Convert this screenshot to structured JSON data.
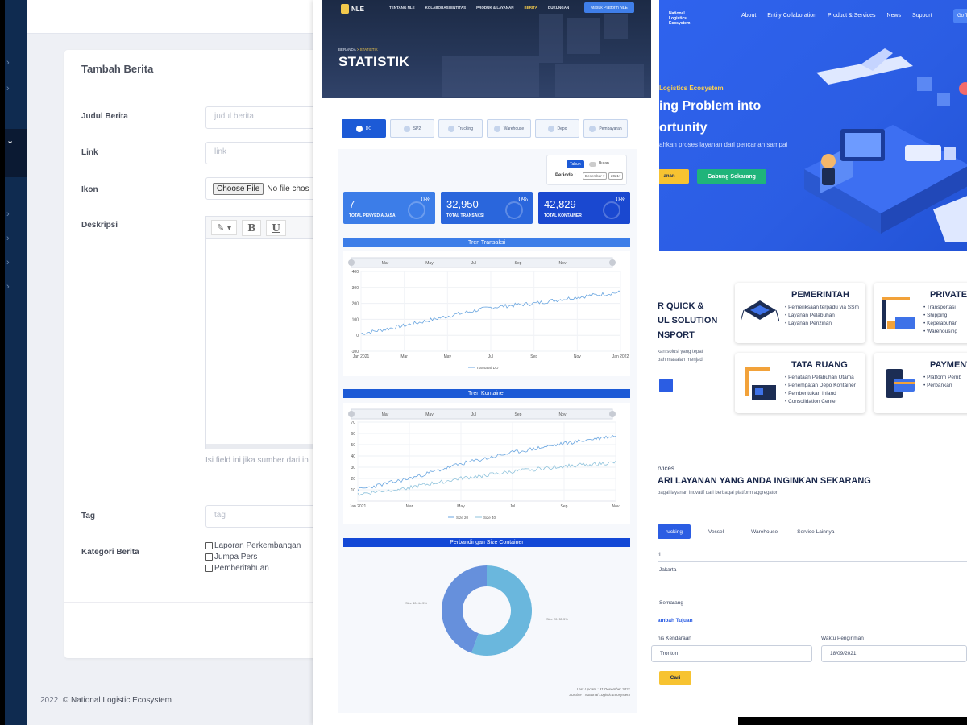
{
  "admin": {
    "card_title": "Tambah Berita",
    "fields": {
      "judul": {
        "label": "Judul Berita",
        "placeholder": "judul berita"
      },
      "link": {
        "label": "Link",
        "placeholder": "link"
      },
      "ikon": {
        "label": "Ikon",
        "button": "Choose File",
        "status": "No file chos"
      },
      "deskripsi": {
        "label": "Deskripsi",
        "hint": "Isi field ini jika sumber dari in"
      },
      "tag": {
        "label": "Tag",
        "placeholder": "tag"
      },
      "kategori": {
        "label": "Kategori Berita",
        "options": [
          "Laporan Perkembangan",
          "Jumpa Pers",
          "Pemberitahuan"
        ]
      }
    },
    "editor_toolbar": {
      "bold": "B",
      "underline": "U"
    },
    "footer_year": "2022",
    "footer_text": "© National Logistic Ecosystem"
  },
  "statistik": {
    "nav": [
      "TENTANG NLE",
      "KOLABORASI ENTITAS",
      "PRODUK & LAYANAN",
      "BERITA",
      "DUKUNGAN"
    ],
    "nav_active": "BERITA",
    "platform_button": "Masuk Platform NLE",
    "breadcrumb_home": "BERANDA",
    "breadcrumb_current": "> STATISTIK",
    "title": "STATISTIK",
    "tabs": [
      "DO",
      "SP2",
      "Trucking",
      "Warehouse",
      "Depo",
      "Pembayaran"
    ],
    "toggle": {
      "tahun": "Tahun",
      "bulan": "Bulan",
      "periode": "Periode :",
      "month": "Desember",
      "year": "2021"
    },
    "cards": [
      {
        "value": "7",
        "label": "TOTAL PENYEDIA JASA",
        "pct": "0%",
        "color": "#3c7de8"
      },
      {
        "value": "32,950",
        "label": "TOTAL TRANSAKSI",
        "pct": "0%",
        "color": "#2a66dc"
      },
      {
        "value": "42,829",
        "label": "TOTAL KONTAINER",
        "pct": "0%",
        "color": "#1a48d0"
      }
    ],
    "chart1_title": "Tren Transaksi",
    "chart2_title": "Tren Kontainer",
    "chart3_title": "Perbandingan Size Container",
    "update_line1": "Last Update : 31 Desember 2021",
    "update_line2": "Sumber : National Logistic Ecosystem"
  },
  "chart_data": [
    {
      "type": "line",
      "title": "Tren Transaksi",
      "x": [
        "Jan 2021",
        "Mar",
        "May",
        "Jul",
        "Sep",
        "Nov",
        "Jan 2022"
      ],
      "ylim": [
        -100,
        400
      ],
      "yticks": [
        "400",
        "300",
        "200",
        "100",
        "0",
        "-100"
      ],
      "navigator_labels": [
        "Mar",
        "May",
        "Jul",
        "Sep",
        "Nov"
      ],
      "series": [
        {
          "name": "Transaksi DO",
          "color": "#6aa6e0",
          "values": [
            10,
            60,
            120,
            175,
            200,
            240,
            270
          ]
        }
      ],
      "legend": "bottom"
    },
    {
      "type": "line",
      "title": "Tren Kontainer",
      "x": [
        "Jan 2021",
        "Mar",
        "May",
        "Jul",
        "Sep",
        "Nov"
      ],
      "ylim": [
        0,
        70
      ],
      "yticks": [
        "70",
        "60",
        "50",
        "40",
        "30",
        "20",
        "10"
      ],
      "navigator_labels": [
        "Mar",
        "May",
        "Jul",
        "Sep",
        "Nov"
      ],
      "series": [
        {
          "name": "Size 20",
          "color": "#6aa6e0",
          "values": [
            10,
            20,
            33,
            43,
            51,
            58
          ]
        },
        {
          "name": "Size 40",
          "color": "#8fc3dc",
          "values": [
            6,
            12,
            20,
            26,
            31,
            34
          ]
        }
      ],
      "legend": "bottom"
    },
    {
      "type": "pie",
      "title": "Perbandingan Size Container",
      "slices": [
        {
          "label": "Size 20",
          "value": 55.5,
          "color": "#6ab7dd",
          "text": "Size 20: 55.5%"
        },
        {
          "label": "Size 40",
          "value": 44.5,
          "color": "#6690dc",
          "text": "Size 40: 44.5%"
        }
      ]
    }
  ],
  "landing": {
    "logo": [
      "National",
      "Logistics",
      "Ecosystem"
    ],
    "nav": [
      "About",
      "Entity Collaboration",
      "Product & Services",
      "News",
      "Support"
    ],
    "goto_button": "Go T",
    "kicker": "Logistics Ecosystem",
    "headline1": "ing Problem into",
    "headline2": "ortunity",
    "subline": "ahkan proses layanan dari  pencarian sampai",
    "btn_primary": "anan",
    "btn_join": "Gabung Sekarang",
    "solution": [
      "R QUICK &",
      "UL SOLUTION",
      "NSPORT"
    ],
    "solution_sub": [
      "kan solusi yang tepat",
      "bah masalah menjadi"
    ],
    "categories": [
      {
        "title": "PEMERINTAH",
        "items": [
          "Pemeriksaan terpadu via SSm",
          "Layanan Pelabuhan",
          "Layanan Perizinan"
        ]
      },
      {
        "title": "PRIVATE S",
        "items": [
          "Transportasi",
          "Shipping",
          "Kepelabuhan",
          "Warehousing"
        ]
      },
      {
        "title": "TATA RUANG",
        "items": [
          "Penataan Pelabuhan Utama",
          "Penempatan Depo Kontainer",
          "Pembentukan Inland",
          "Consolidation Center"
        ]
      },
      {
        "title": "PAYMENT",
        "items": [
          "Platform Pemb",
          "Perbankan"
        ]
      }
    ],
    "services_kicker": "rvices",
    "services_title": "ARI LAYANAN YANG ANDA INGINKAN SEKARANG",
    "services_sub": "bagai layanan inovatif dari berbagai platform aggregator",
    "service_tabs": [
      "rucking",
      "Vessel",
      "Warehouse",
      "Service Lainnya"
    ],
    "form": {
      "asal_label": "ri",
      "asal_value": "Jakarta",
      "tujuan_value": "Semarang",
      "tambah": "ambah Tujuan",
      "jenis_label": "nis Kendaraan",
      "jenis_value": "Tronton",
      "waktu_label": "Waktu Pengiriman",
      "waktu_value": "18/09/2021",
      "cari": "Cari"
    }
  }
}
